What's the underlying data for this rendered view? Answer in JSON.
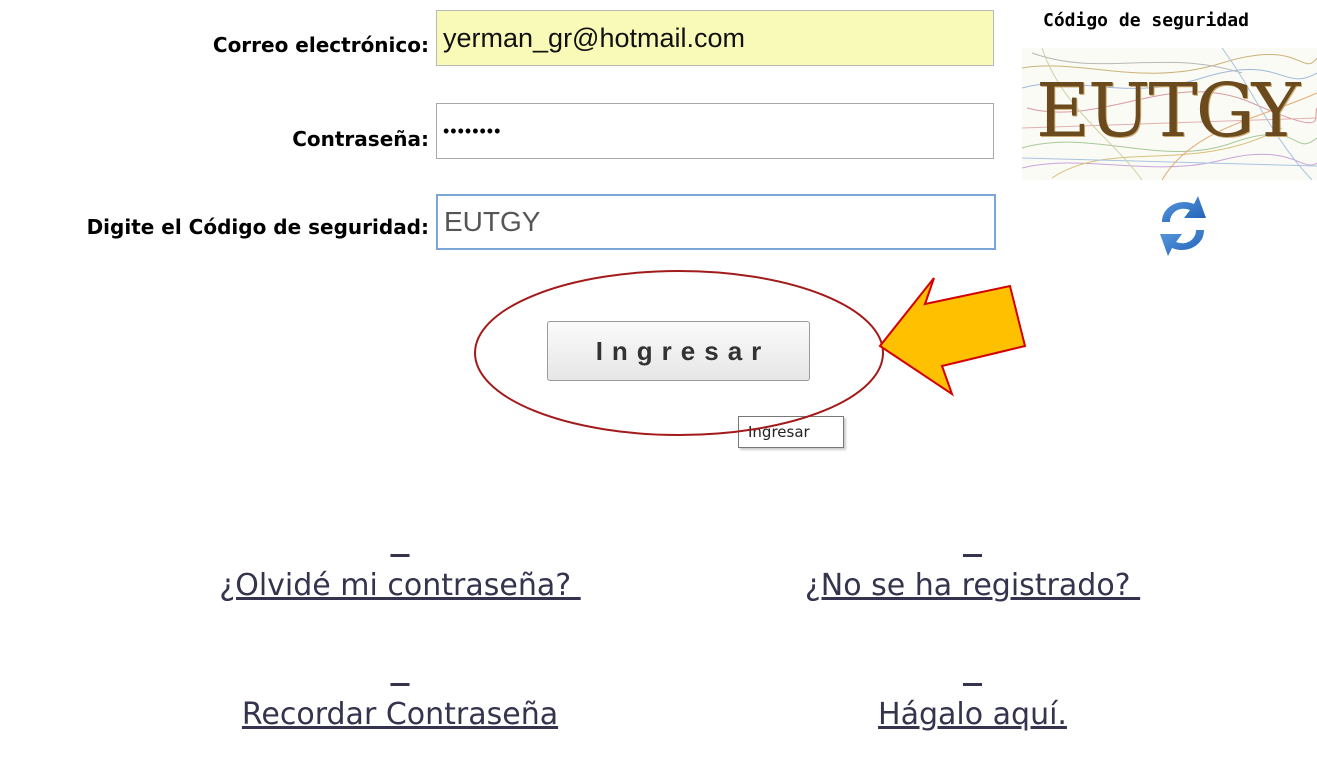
{
  "form": {
    "email_label": "Correo electrónico:",
    "email_value": "yerman_gr@hotmail.com",
    "password_label": "Contraseña:",
    "password_value": "••••••••",
    "captcha_input_label": "Digite el Código de seguridad:",
    "captcha_input_value": "EUTGY",
    "submit_label": "Ingresar",
    "tooltip": "Ingresar"
  },
  "captcha": {
    "title": "Código de seguridad",
    "code": "EUTGY",
    "refresh_icon": "refresh-icon"
  },
  "links": {
    "forgot_line1": "¿Olvidé mi contraseña? ",
    "forgot_line2": "Recordar Contraseña",
    "register_line1": "¿No se ha registrado? ",
    "register_line2": "Hágalo aquí."
  },
  "annotations": {
    "circle_color": "#a31a1a",
    "arrow_fill": "#ffc000",
    "arrow_stroke": "#d40000"
  },
  "colors": {
    "email_bg": "#fafab8",
    "link_color": "#34344f"
  }
}
